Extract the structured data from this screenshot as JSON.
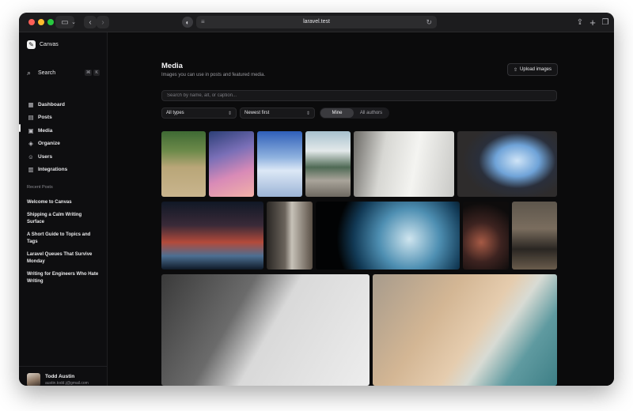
{
  "browser": {
    "url": "laravel.test"
  },
  "sidebar": {
    "brand": "Canvas",
    "search_label": "Search",
    "search_shortcut": [
      "⌘",
      "K"
    ],
    "nav": [
      {
        "label": "Dashboard",
        "icon": "dashboard-icon"
      },
      {
        "label": "Posts",
        "icon": "posts-icon"
      },
      {
        "label": "Media",
        "icon": "media-icon",
        "active": true
      },
      {
        "label": "Organize",
        "icon": "organize-icon"
      },
      {
        "label": "Users",
        "icon": "users-icon"
      },
      {
        "label": "Integrations",
        "icon": "integrations-icon"
      }
    ],
    "recent_heading": "Recent Posts",
    "recent_posts": [
      "Welcome to Canvas",
      "Shipping a Calm Writing Surface",
      "A Short Guide to Topics and Tags",
      "Laravel Queues That Survive Monday",
      "Writing for Engineers Who Hate Writing"
    ],
    "user": {
      "name": "Todd Austin",
      "email": "austin.todd.j@gmail.com"
    }
  },
  "main": {
    "title": "Media",
    "subtitle": "Images you can use in posts and featured media.",
    "upload_label": "Upload images",
    "search_placeholder": "Search by name, alt, or caption...",
    "type_filter": "All types",
    "sort": "Newest first",
    "segments": {
      "mine": "Mine",
      "all": "All authors",
      "selected": "Mine"
    }
  },
  "colors": {
    "background": "#0b0b0c",
    "sidebar": "#0e0e10",
    "accent": "#f2f2f2"
  }
}
